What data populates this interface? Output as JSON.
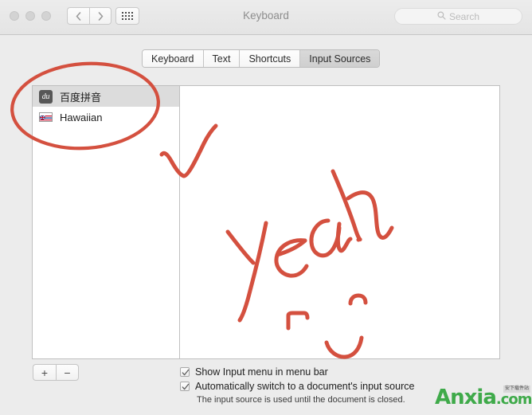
{
  "window": {
    "title": "Keyboard"
  },
  "toolbar": {
    "back_icon": "chevron-left-icon",
    "forward_icon": "chevron-right-icon",
    "grid_icon": "show-all-grid-icon",
    "search": {
      "placeholder": "Search",
      "value": "",
      "icon": "search-icon"
    }
  },
  "tabs": [
    {
      "label": "Keyboard",
      "selected": false
    },
    {
      "label": "Text",
      "selected": false
    },
    {
      "label": "Shortcuts",
      "selected": false
    },
    {
      "label": "Input Sources",
      "selected": true
    }
  ],
  "input_sources": {
    "items": [
      {
        "label": "百度拼音",
        "icon": "baidu-pinyin-icon",
        "icon_text": "du",
        "selected": true
      },
      {
        "label": "Hawaiian",
        "icon": "hawaiian-flag-icon",
        "icon_text": "",
        "selected": false
      }
    ],
    "add_button": "+",
    "remove_button": "−"
  },
  "options": [
    {
      "label": "Show Input menu in menu bar",
      "checked": true
    },
    {
      "label": "Automatically switch to a document's input source",
      "checked": true
    }
  ],
  "options_hint": "The input source is used until the document is closed.",
  "annotations": {
    "circle_color": "#d4503f",
    "ink_color": "#d4503f",
    "handwriting": "yeah",
    "checkmark": "check-stroke",
    "smiley": "smiley-stroke"
  },
  "watermark": {
    "text": "Anxia",
    "suffix": ".com",
    "sub": "安下载件站",
    "color": "#3faa4a"
  }
}
